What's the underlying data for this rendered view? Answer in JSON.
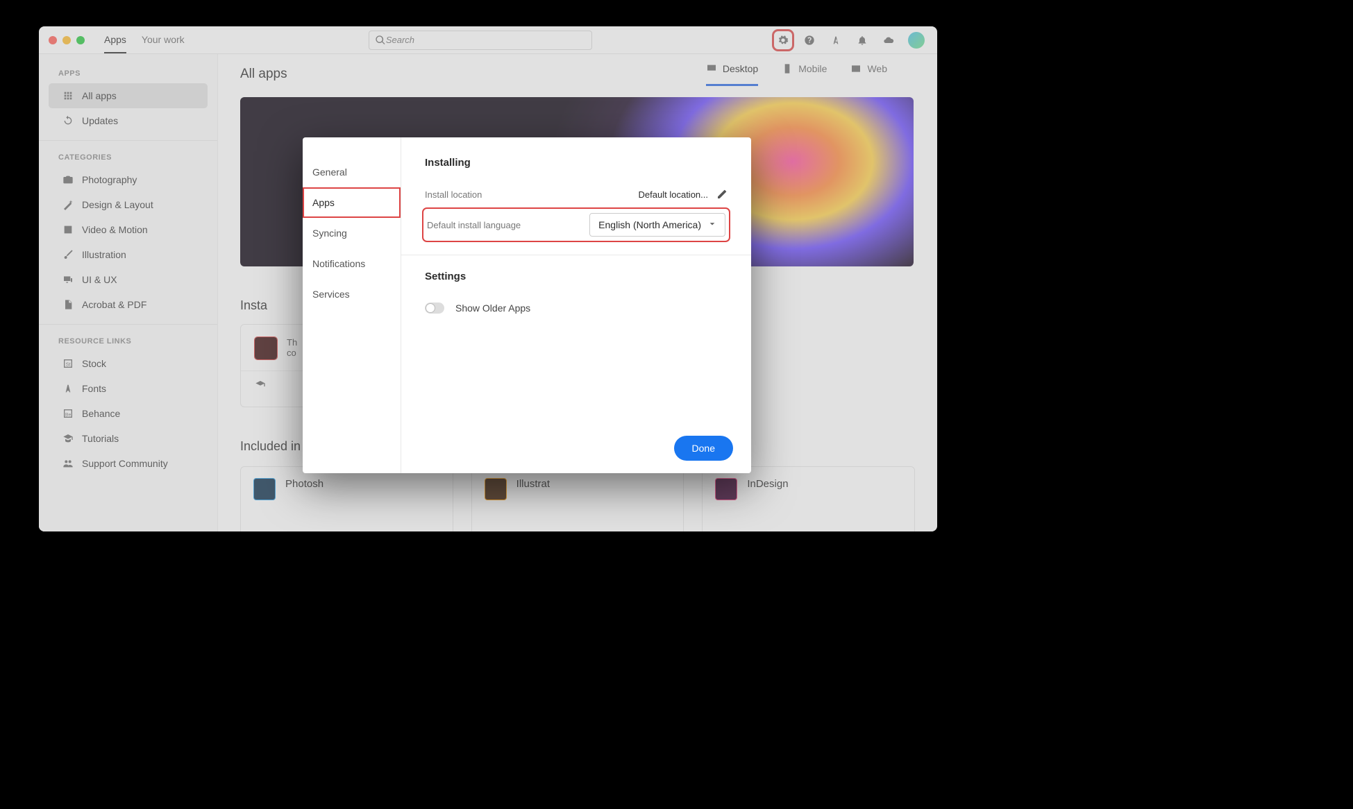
{
  "top": {
    "tabs": [
      "Apps",
      "Your work"
    ],
    "search_placeholder": "Search"
  },
  "sidebar": {
    "apps_head": "APPS",
    "all_apps": "All apps",
    "updates": "Updates",
    "cat_head": "CATEGORIES",
    "cats": [
      "Photography",
      "Design & Layout",
      "Video & Motion",
      "Illustration",
      "UI & UX",
      "Acrobat & PDF"
    ],
    "res_head": "RESOURCE LINKS",
    "res": [
      "Stock",
      "Fonts",
      "Behance",
      "Tutorials",
      "Support Community"
    ]
  },
  "main": {
    "title": "All apps",
    "dtabs": [
      "Desktop",
      "Mobile",
      "Web"
    ],
    "installed_head": "Insta",
    "insta_line1": "Th",
    "insta_line2": "co",
    "included_head": "Included in your subscription",
    "apps": [
      "Photosh",
      "Illustrat",
      "InDesign"
    ]
  },
  "modal": {
    "side": [
      "General",
      "Apps",
      "Syncing",
      "Notifications",
      "Services"
    ],
    "installing": "Installing",
    "install_loc_label": "Install location",
    "install_loc_value": "Default location...",
    "lang_label": "Default install language",
    "lang_value": "English (North America)",
    "settings": "Settings",
    "show_older": "Show Older Apps",
    "done": "Done"
  }
}
